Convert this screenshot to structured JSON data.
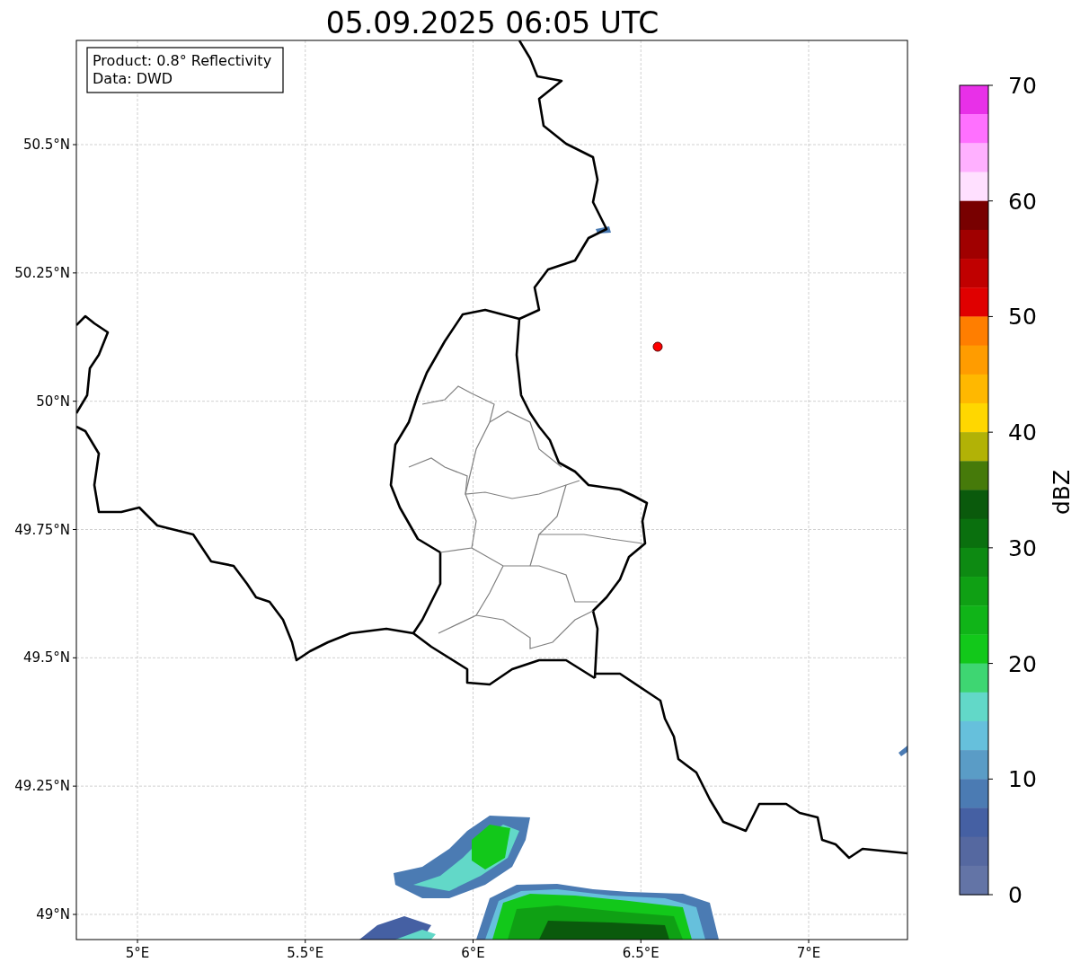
{
  "title": "05.09.2025 06:05 UTC",
  "info_box": [
    "Product: 0.8° Reflectivity",
    "Data: DWD"
  ],
  "map": {
    "xticks": [
      "5°E",
      "5.5°E",
      "6°E",
      "6.5°E",
      "7°E"
    ],
    "yticks": [
      "50.5°N",
      "50.25°N",
      "50°N",
      "49.75°N",
      "49.5°N",
      "49.25°N",
      "49°N"
    ]
  },
  "colorbar": {
    "label": "dBZ",
    "ticks": [
      "70",
      "60",
      "50",
      "40",
      "30",
      "20",
      "10",
      "0"
    ],
    "segments": [
      {
        "color": "#e830e8"
      },
      {
        "color": "#ff70ff"
      },
      {
        "color": "#ffb0ff"
      },
      {
        "color": "#ffe0ff"
      },
      {
        "color": "#780000"
      },
      {
        "color": "#a00000"
      },
      {
        "color": "#c00000"
      },
      {
        "color": "#e00000"
      },
      {
        "color": "#ff7e00"
      },
      {
        "color": "#ff9c00"
      },
      {
        "color": "#ffb800"
      },
      {
        "color": "#ffd700"
      },
      {
        "color": "#b2b206"
      },
      {
        "color": "#467a0a"
      },
      {
        "color": "#0a5a0c"
      },
      {
        "color": "#0a700e"
      },
      {
        "color": "#0d8a12"
      },
      {
        "color": "#0fa014"
      },
      {
        "color": "#10b418"
      },
      {
        "color": "#12c81a"
      },
      {
        "color": "#3ed672"
      },
      {
        "color": "#62d8c8"
      },
      {
        "color": "#66c0dc"
      },
      {
        "color": "#5a9cc6"
      },
      {
        "color": "#4b7bb3"
      },
      {
        "color": "#4560a3"
      },
      {
        "color": "#5568a0"
      },
      {
        "color": "#6374a6"
      }
    ]
  }
}
